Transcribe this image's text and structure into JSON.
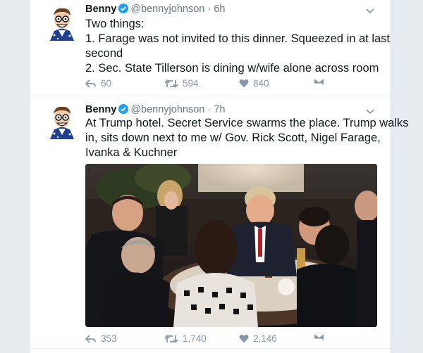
{
  "tweets": [
    {
      "name": "Benny",
      "handle": "@bennyjohnson",
      "time": "6h",
      "lines": [
        "Two things:",
        "1. Farage was not invited to this dinner. Squeezed in at last",
        "second",
        "2. Sec. State Tillerson is dining  w/wife alone across room"
      ],
      "replies": "60",
      "retweets": "594",
      "likes": "840"
    },
    {
      "name": "Benny",
      "handle": "@bennyjohnson",
      "time": "7h",
      "lines": [
        "At Trump hotel. Secret Service swarms the place. Trump walks",
        "in, sits down next to me w/ Gov. Rick Scott, Nigel Farage,",
        "Ivanka & Kuchner"
      ],
      "replies": "353",
      "retweets": "1,740",
      "likes": "2,146"
    }
  ],
  "colors": {
    "verified": "#1da1f2",
    "action_gray": "#8899a6",
    "handle_gray": "#657786"
  },
  "icons": [
    "verified-badge-icon",
    "caret-down-icon",
    "reply-icon",
    "retweet-icon",
    "like-icon",
    "direct-message-icon"
  ]
}
